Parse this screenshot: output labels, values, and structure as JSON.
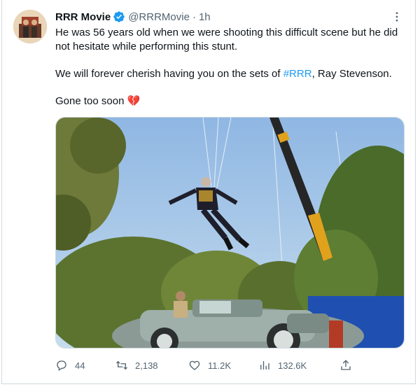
{
  "tweet": {
    "author_name": "RRR Movie",
    "handle": "@RRRMovie",
    "separator": "·",
    "time": "1h",
    "more_label": "⋮",
    "line1": "He was 56 years old when we were shooting this difficult scene but he did not hesitate while performing this stunt.",
    "line2_prefix": "We will forever cherish having you on the sets of ",
    "hashtag": "#RRR",
    "line2_suffix": ", Ray Stevenson.",
    "line3": "Gone too soon",
    "emoji": "💔"
  },
  "media": {
    "alt": "Photo of actor performing a harness stunt above a vintage car, with a crane against blue sky"
  },
  "actions": {
    "replies": "44",
    "retweets": "2,138",
    "likes": "11.2K",
    "views": "132.6K"
  },
  "colors": {
    "accent": "#1d9bf0",
    "muted": "#536471",
    "text": "#0f1419"
  },
  "icons": [
    "verified-badge-icon",
    "more-icon",
    "reply-icon",
    "retweet-icon",
    "like-icon",
    "views-icon",
    "share-icon"
  ]
}
